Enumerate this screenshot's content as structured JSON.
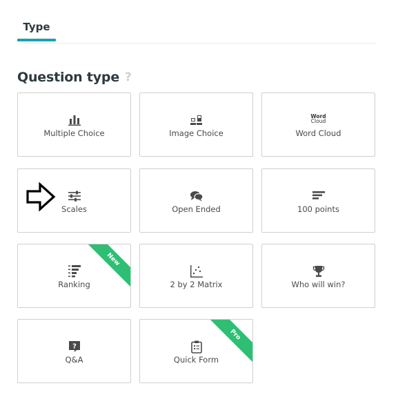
{
  "tabs": [
    {
      "label": "Type",
      "active": true
    }
  ],
  "section": {
    "title": "Question type",
    "help": "?"
  },
  "cards": [
    {
      "label": "Multiple Choice",
      "icon": "bar-chart-icon"
    },
    {
      "label": "Image Choice",
      "icon": "image-choice-icon"
    },
    {
      "label": "Word Cloud",
      "icon": "word-cloud-icon",
      "icon_text": [
        "Word",
        "Cloud"
      ]
    },
    {
      "label": "Scales",
      "icon": "sliders-icon"
    },
    {
      "label": "Open Ended",
      "icon": "chat-bubbles-icon"
    },
    {
      "label": "100 points",
      "icon": "stacked-lines-icon"
    },
    {
      "label": "Ranking",
      "icon": "ranking-icon",
      "badge": "New"
    },
    {
      "label": "2 by 2 Matrix",
      "icon": "scatter-matrix-icon"
    },
    {
      "label": "Who will win?",
      "icon": "trophy-icon"
    },
    {
      "label": "Q&A",
      "icon": "question-box-icon",
      "icon_text": [
        "?"
      ]
    },
    {
      "label": "Quick Form",
      "icon": "clipboard-form-icon",
      "badge": "Pro"
    }
  ],
  "colors": {
    "accent": "#1aa2b3",
    "ribbon": "#2ebf74",
    "icon": "#4a4a4a",
    "border": "#cfcfcf"
  }
}
